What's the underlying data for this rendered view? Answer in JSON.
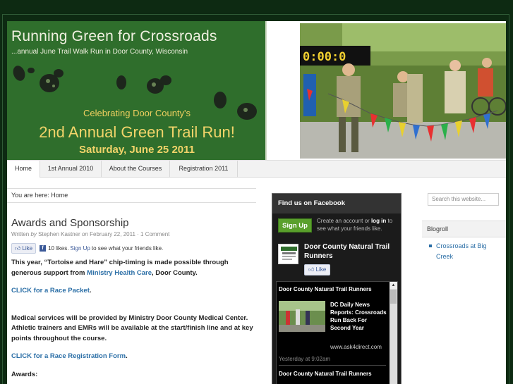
{
  "site": {
    "title": "Running Green for Crossroads",
    "tagline": "...annual June Trail Walk Run in Door County, Wisconsin",
    "celebrating": "Celebrating Door County's",
    "event_name": "2nd Annual Green Trail Run!",
    "event_date": "Saturday, June 25 2011",
    "photo_clock": "0:00:0"
  },
  "nav": {
    "items": [
      "Home",
      "1st Annual 2010",
      "About the Courses",
      "Registration 2011"
    ],
    "active": "Home"
  },
  "breadcrumb": "You are here: Home",
  "post": {
    "title": "Awards and Sponsorship",
    "written_by": "Written",
    "by": "by",
    "author": "Stephen Kastner",
    "on": "on",
    "date": "February 22, 2011",
    "sep": "·",
    "comments": "1 Comment",
    "like_label": "Like",
    "like_count": "10 likes.",
    "signup_link": "Sign Up",
    "signup_text": "to see what your friends like.",
    "p1_a": "This year, “Tortoise and Hare” chip-timing is made possible through generous support from",
    "p1_link": "Ministry Health Care",
    "p1_b": ", Door County.",
    "packet_link": "CLICK for a Race Packet",
    "period": ".",
    "medical": "Medical services will be provided by Ministry Door County Medical Center. Athletic trainers and EMRs will be available at the start/finish line and at key points throughout the course.",
    "reg_link": "CLICK for a Race Registration Form",
    "awards": "Awards:"
  },
  "facebook": {
    "header": "Find us on Facebook",
    "signup_button": "Sign Up",
    "create_text": "Create an account or",
    "login": "log in",
    "create_text2": "to see what your friends like.",
    "page_name": "Door County Natural Trail Runners",
    "like_label": "Like",
    "stream": {
      "author": "Door County Natural Trail Runners",
      "text": "DC Daily News Reports: Crossroads Run Back For Second Year",
      "url": "www.ask4direct.com",
      "time": "Yesterday at 9:02am",
      "author2": "Door County Natural Trail Runners"
    }
  },
  "sidebar": {
    "search_placeholder": "Search this website...",
    "blogroll_title": "Blogroll",
    "blogroll_items": [
      "Crossroads at Big Creek"
    ]
  },
  "colors": {
    "banner_green": "#2f6e2c",
    "page_bg": "#0d2a12",
    "link_blue": "#2a6ea6",
    "event_yellow": "#f2d46a",
    "fb_green": "#5aa02c"
  }
}
